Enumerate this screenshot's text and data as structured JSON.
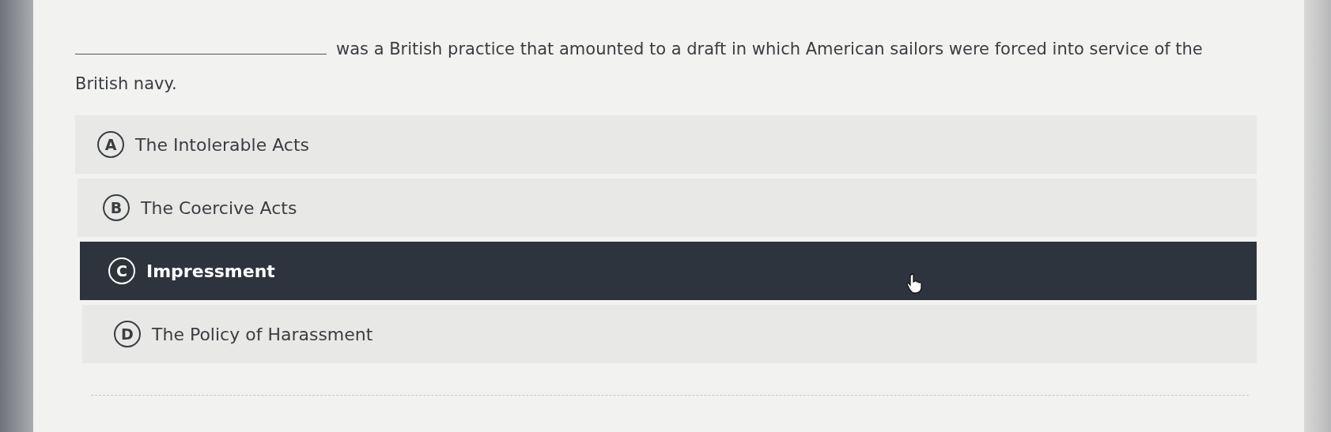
{
  "question": {
    "lines": [
      "was a British practice that amounted to a draft in which American sailors were forced into service of the",
      "British navy."
    ]
  },
  "options": [
    {
      "letter": "A",
      "text": "The Intolerable Acts",
      "selected": false
    },
    {
      "letter": "B",
      "text": "The Coercive Acts",
      "selected": false
    },
    {
      "letter": "C",
      "text": "Impressment",
      "selected": true
    },
    {
      "letter": "D",
      "text": "The Policy of Harassment",
      "selected": false
    }
  ]
}
